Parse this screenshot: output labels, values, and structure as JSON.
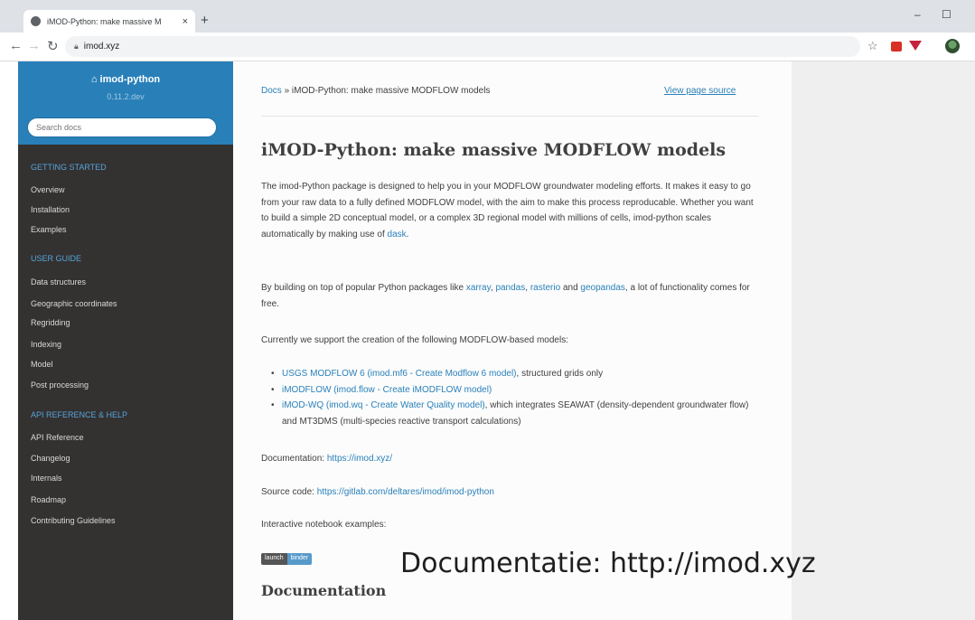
{
  "browser": {
    "tab_title": "iMOD-Python: make massive M",
    "tab_close": "×",
    "new_tab": "+",
    "url": "imod.xyz",
    "minimize": "–",
    "maximize": "☐"
  },
  "sidebar": {
    "project": "imod-python",
    "version": "0.11.2.dev",
    "search_placeholder": "Search docs",
    "sections": [
      {
        "caption": "GETTING STARTED",
        "items": [
          "Overview",
          "Installation",
          "Examples"
        ]
      },
      {
        "caption": "USER GUIDE",
        "items": [
          "Data structures",
          "Geographic coordinates",
          "Regridding",
          "Indexing",
          "Model",
          "Post processing"
        ]
      },
      {
        "caption": "API REFERENCE & HELP",
        "items": [
          "API Reference",
          "Changelog",
          "Internals",
          "Roadmap",
          "Contributing Guidelines"
        ]
      }
    ]
  },
  "breadcrumb": {
    "docs": "Docs",
    "separator": "»",
    "current": "iMOD-Python: make massive MODFLOW models"
  },
  "view_source": "View page source",
  "page_title": "iMOD-Python: make massive MODFLOW models",
  "intro": {
    "text": "The imod-Python package is designed to help you in your MODFLOW groundwater modeling efforts. It makes it easy to go from your raw data to a fully defined MODFLOW model, with the aim to make this process reproducable. Whether you want to build a simple 2D conceptual model, or a complex 3D regional model with millions of cells, imod-python scales automatically by making use of ",
    "link": "dask",
    "end": "."
  },
  "packages": {
    "prefix": "By building on top of popular Python packages like ",
    "xarray": "xarray",
    "sep1": ", ",
    "pandas": "pandas",
    "sep2": ", ",
    "rasterio": "rasterio",
    "and": " and ",
    "geopandas": "geopandas",
    "suffix": ", a lot of functionality comes for free."
  },
  "support_intro": "Currently we support the creation of the following MODFLOW-based models:",
  "models": [
    {
      "link": "USGS MODFLOW 6 (imod.mf6 - Create Modflow 6 model)",
      "rest": ", structured grids only"
    },
    {
      "link": "iMODFLOW (imod.flow - Create iMODFLOW model)",
      "rest": ""
    },
    {
      "link": "iMOD-WQ (imod.wq - Create Water Quality model)",
      "rest": ", which integrates SEAWAT (density-dependent groundwater flow) and MT3DMS (multi-species reactive transport calculations)"
    }
  ],
  "documentation_line": {
    "label": "Documentation: ",
    "link": "https://imod.xyz/"
  },
  "source_line": {
    "label": "Source code: ",
    "link": "https://gitlab.com/deltares/imod/imod-python"
  },
  "notebook_text": "Interactive notebook examples:",
  "binder_badge": {
    "left": "launch",
    "right": "binder"
  },
  "section_heading": "Documentation",
  "annotation": "Documentatie: http://imod.xyz"
}
